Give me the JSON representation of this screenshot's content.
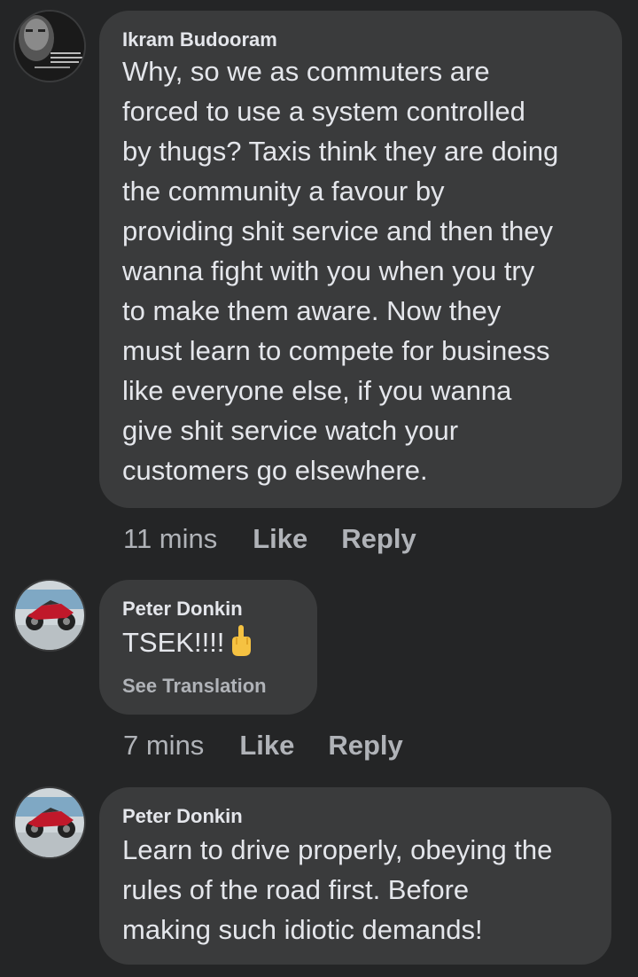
{
  "comments": [
    {
      "author": "Ikram Budooram",
      "text": "Why, so we as commuters are\nforced to use a system controlled\nby thugs? Taxis think they are doing\nthe community a favour by\nproviding shit service and then they\nwanna fight with you when you try\nto make them aware. Now they\nmust learn to compete for business\nlike everyone else, if you wanna\ngive shit service watch your\ncustomers go elsewhere.",
      "time": "11 mins",
      "like_label": "Like",
      "reply_label": "Reply"
    },
    {
      "author": "Peter Donkin",
      "text": "TSEK!!!!",
      "emoji": "middle-finger-emoji",
      "translation_label": "See Translation",
      "time": "7 mins",
      "like_label": "Like",
      "reply_label": "Reply"
    },
    {
      "author": "Peter Donkin",
      "text": "Learn to drive properly, obeying the\nrules of the road first. Before\nmaking such idiotic demands!"
    }
  ],
  "colors": {
    "background": "#242526",
    "bubble": "#3a3b3c",
    "text_primary": "#e4e6eb",
    "text_secondary": "#b0b3b8"
  }
}
